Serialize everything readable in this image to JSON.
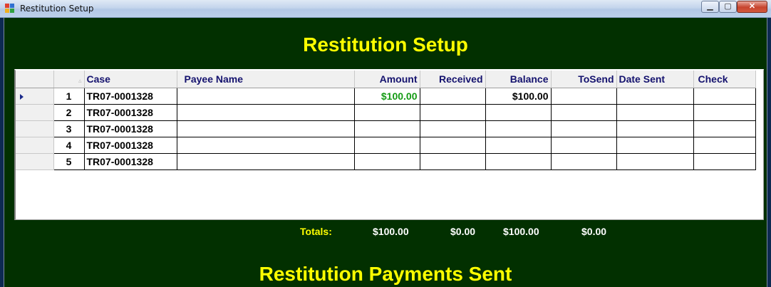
{
  "window": {
    "title": "Restitution Setup"
  },
  "setup": {
    "heading": "Restitution Setup",
    "columns": [
      "Case",
      "Payee Name",
      "Amount",
      "Received",
      "Balance",
      "ToSend",
      "Date Sent",
      "Check"
    ],
    "rows": [
      {
        "num": "1",
        "case": "TR07-0001328",
        "payee": "",
        "amount": "$100.00",
        "received": "",
        "balance": "$100.00",
        "tosend": "",
        "date_sent": "",
        "check": ""
      },
      {
        "num": "2",
        "case": "TR07-0001328",
        "payee": "",
        "amount": "",
        "received": "",
        "balance": "",
        "tosend": "",
        "date_sent": "",
        "check": ""
      },
      {
        "num": "3",
        "case": "TR07-0001328",
        "payee": "",
        "amount": "",
        "received": "",
        "balance": "",
        "tosend": "",
        "date_sent": "",
        "check": ""
      },
      {
        "num": "4",
        "case": "TR07-0001328",
        "payee": "",
        "amount": "",
        "received": "",
        "balance": "",
        "tosend": "",
        "date_sent": "",
        "check": ""
      },
      {
        "num": "5",
        "case": "TR07-0001328",
        "payee": "",
        "amount": "",
        "received": "",
        "balance": "",
        "tosend": "",
        "date_sent": "",
        "check": ""
      }
    ],
    "totals": {
      "label": "Totals:",
      "amount": "$100.00",
      "received": "$0.00",
      "balance": "$100.00",
      "tosend": "$0.00"
    }
  },
  "sent": {
    "heading": "Restitution Payments Sent"
  },
  "colors": {
    "background": "#023000",
    "heading": "#ffff00",
    "amount_green": "#149b14"
  },
  "icons": {
    "app": "app-icon",
    "minimize": "minimize-icon",
    "maximize": "maximize-icon",
    "close": "close-icon",
    "current_row": "row-selector-arrow-icon"
  }
}
